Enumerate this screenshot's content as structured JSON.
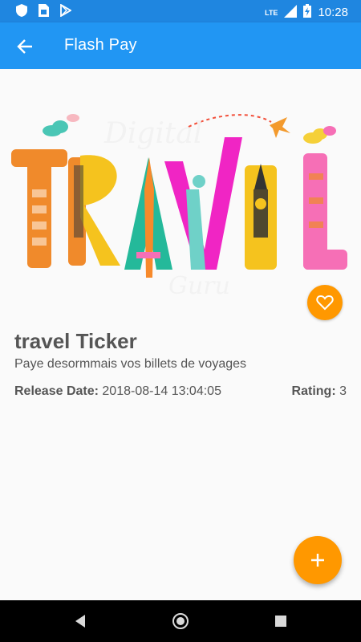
{
  "status_bar": {
    "time": "10:28",
    "network_label": "LTE",
    "icons": [
      "shield-icon",
      "sim-card-icon",
      "play-store-icon",
      "signal-icon",
      "battery-charging-icon"
    ]
  },
  "app_bar": {
    "title": "Flash Pay",
    "back_icon": "arrow-back-icon",
    "color": "#2196f3"
  },
  "hero": {
    "logo_top_word": "Digital",
    "logo_main_word": "TRAVEL",
    "logo_bottom_word": "Guru"
  },
  "item": {
    "title": "travel Ticker",
    "description": "Paye desormmais vos billets de voyages",
    "release_label": "Release Date:",
    "release_value": " 2018-08-14 13:04:05",
    "rating_label": "Rating:",
    "rating_value": " 3",
    "favorite_icon": "heart-outline-icon",
    "accent_color": "#ff9800"
  },
  "fab": {
    "icon": "plus-icon"
  },
  "nav_bar": {
    "icons": [
      "back-triangle-icon",
      "home-circle-icon",
      "recents-square-icon"
    ]
  }
}
